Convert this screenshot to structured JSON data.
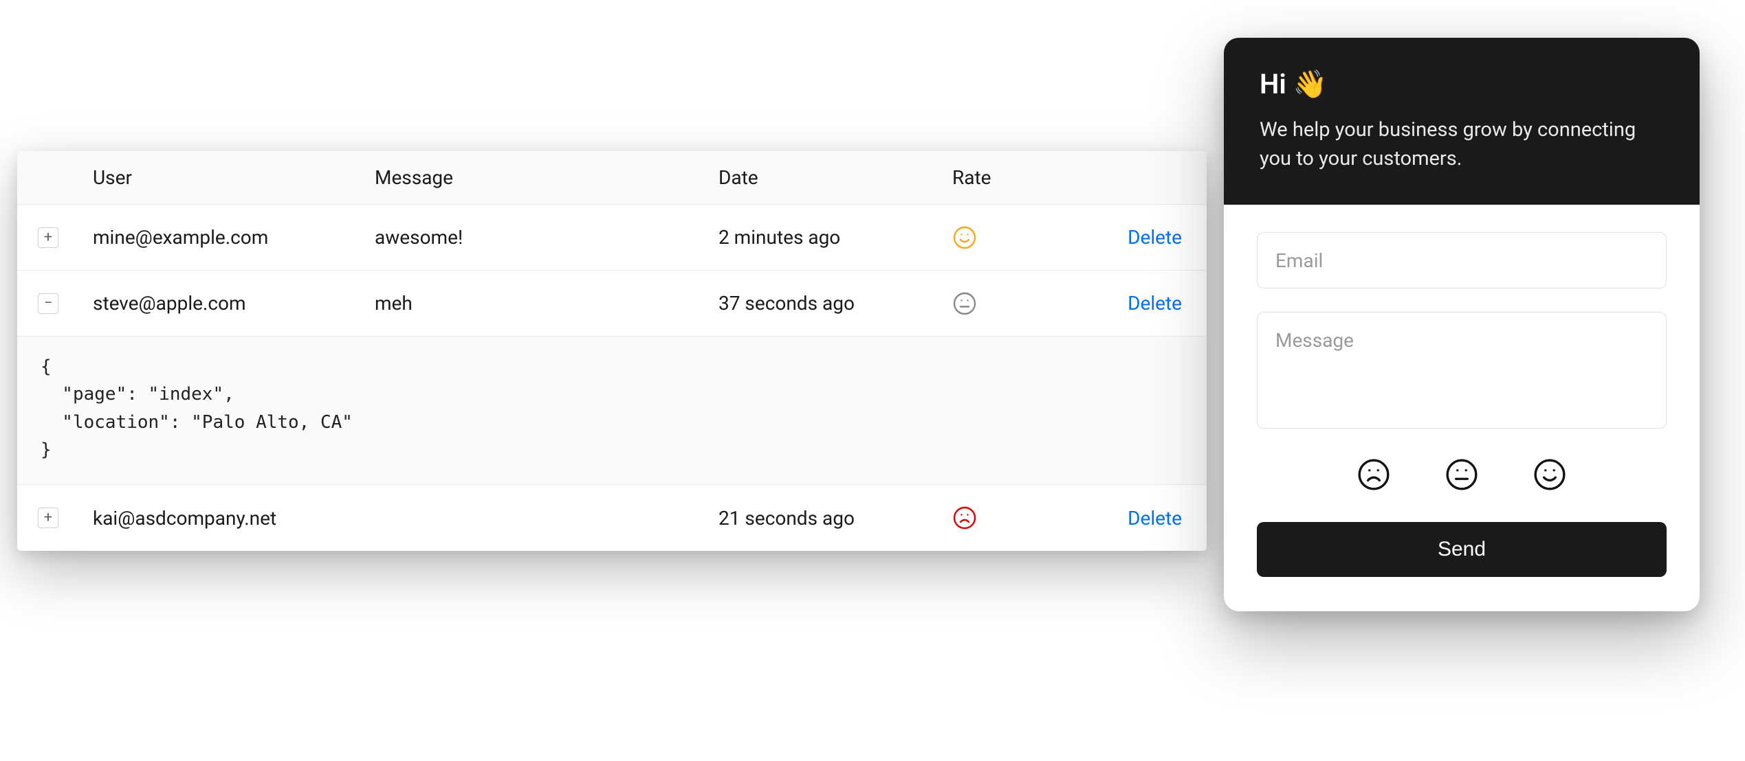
{
  "table": {
    "columns": {
      "user": "User",
      "message": "Message",
      "date": "Date",
      "rate": "Rate"
    },
    "delete_label": "Delete",
    "rows": [
      {
        "expand_symbol": "+",
        "user": "mine@example.com",
        "message": "awesome!",
        "date": "2 minutes ago",
        "rate": "happy",
        "rate_color": "#f5a623"
      },
      {
        "expand_symbol": "−",
        "user": "steve@apple.com",
        "message": "meh",
        "date": "37 seconds ago",
        "rate": "neutral",
        "rate_color": "#888888",
        "expanded_json": "{\n  \"page\": \"index\",\n  \"location\": \"Palo Alto, CA\"\n}"
      },
      {
        "expand_symbol": "+",
        "user": "kai@asdcompany.net",
        "message": "",
        "date": "21 seconds ago",
        "rate": "sad",
        "rate_color": "#e00000"
      }
    ]
  },
  "widget": {
    "title_text": "Hi",
    "title_emoji": "👋",
    "subtitle": "We help your business grow by connecting you to your customers.",
    "email_placeholder": "Email",
    "message_placeholder": "Message",
    "send_label": "Send"
  }
}
